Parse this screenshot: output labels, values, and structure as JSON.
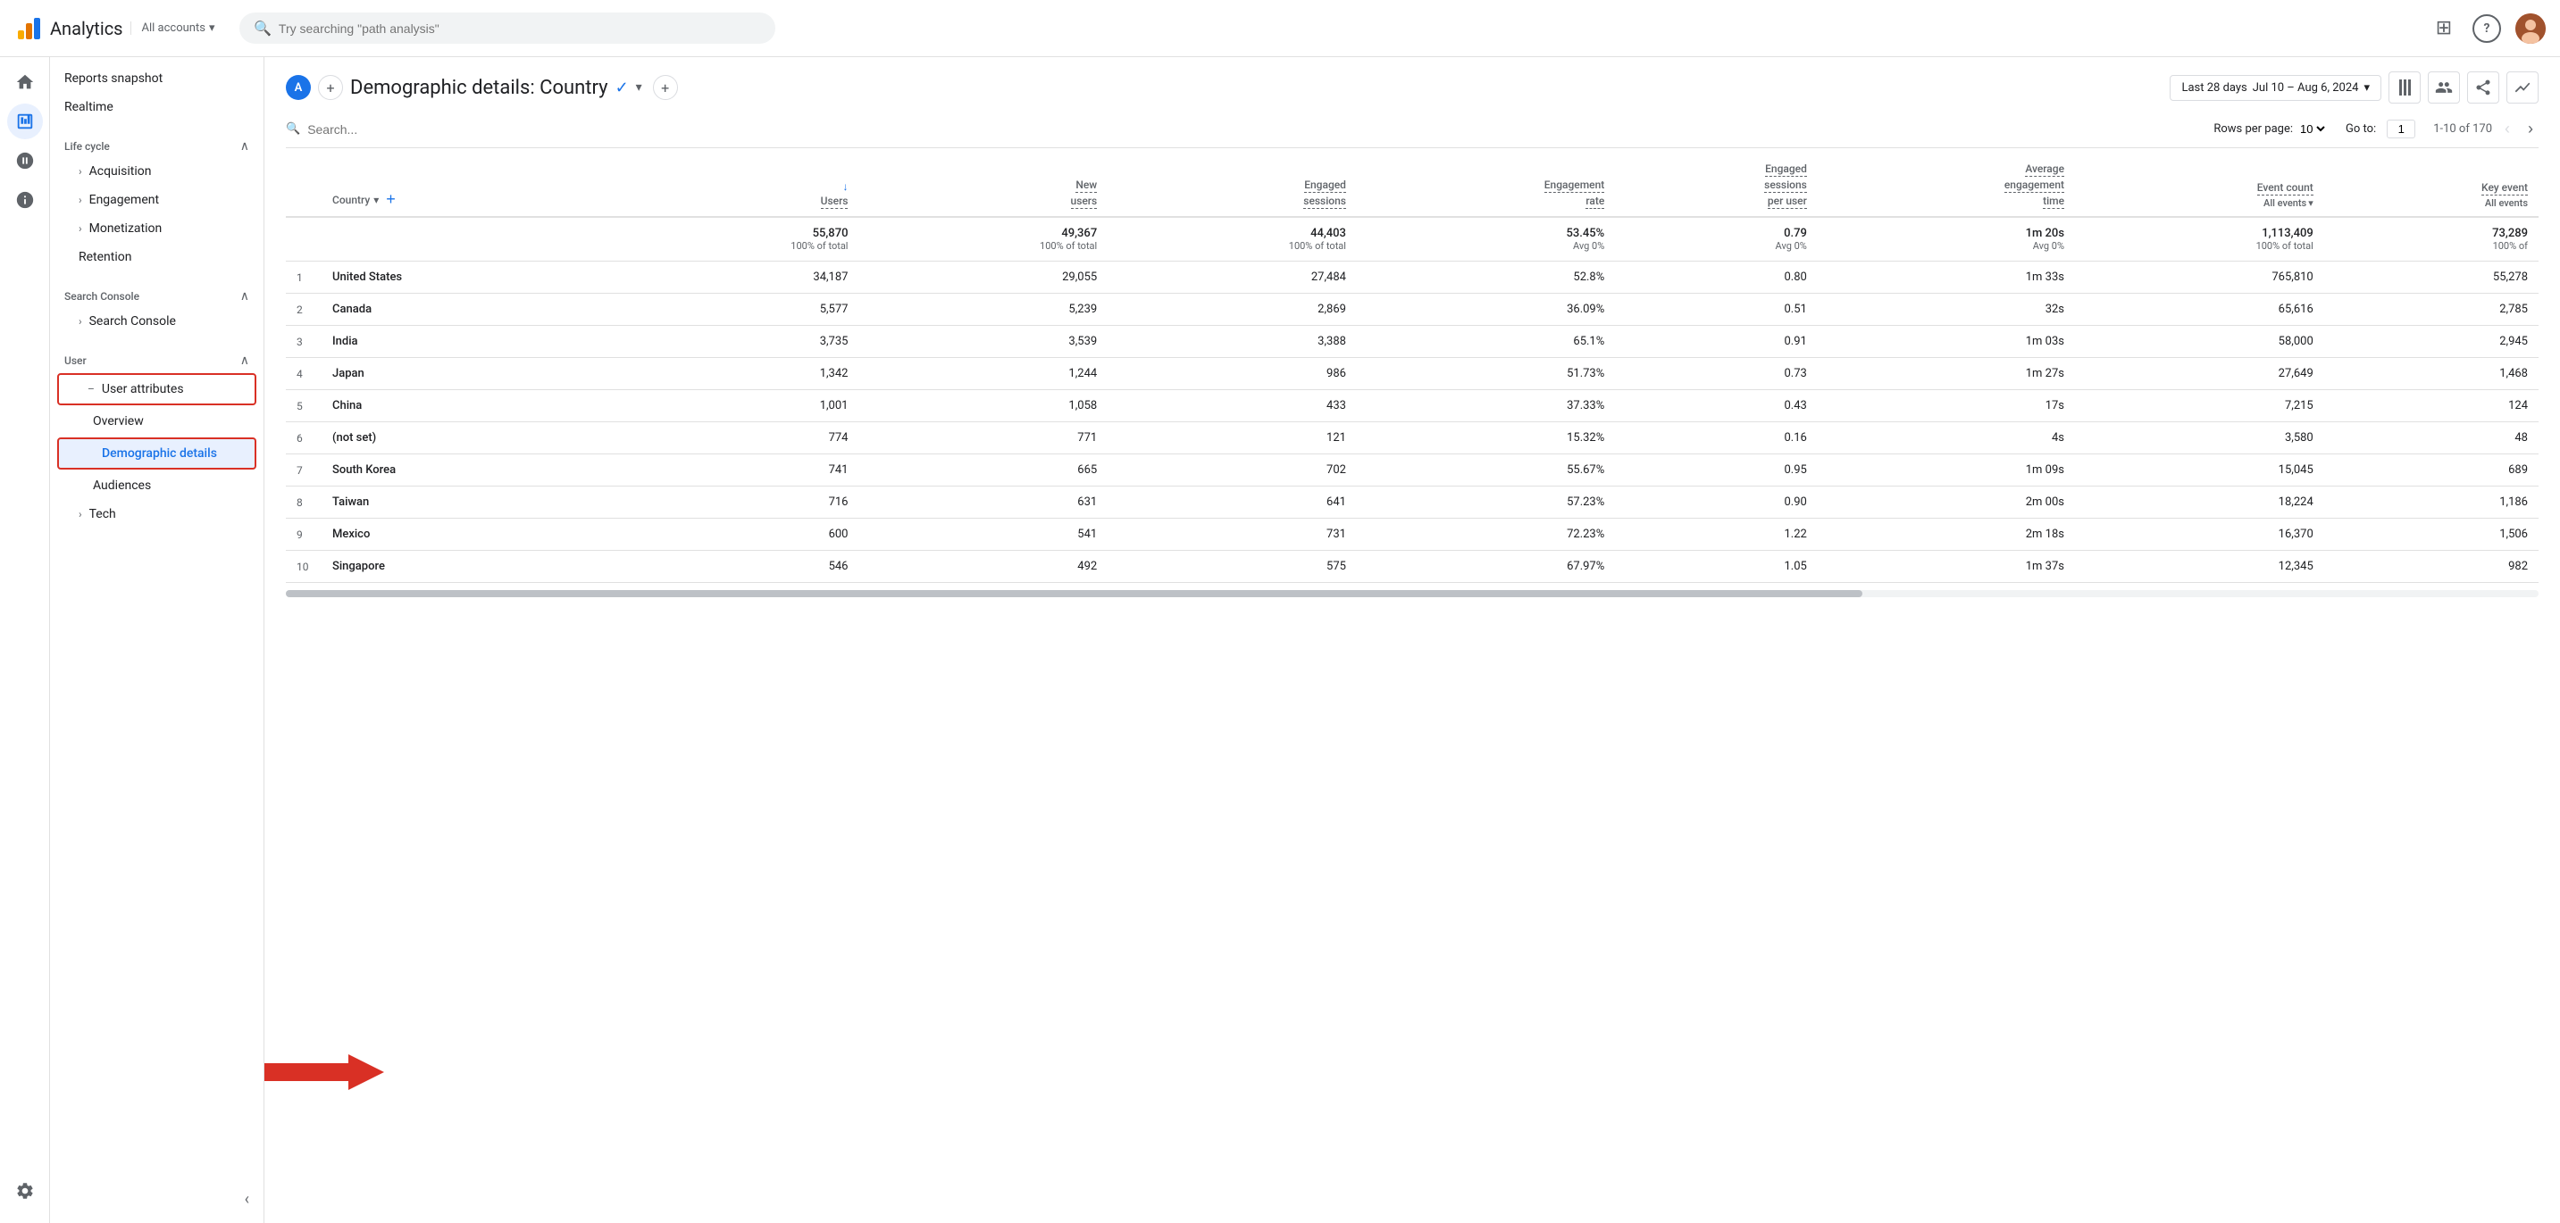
{
  "app": {
    "title": "Analytics",
    "all_accounts": "All accounts"
  },
  "topbar": {
    "search_placeholder": "Try searching \"path analysis\"",
    "date_range": "Last 28 days  Jul 10 – Aug 6, 2024"
  },
  "sidebar": {
    "reports_snapshot": "Reports snapshot",
    "realtime": "Realtime",
    "lifecycle_label": "Life cycle",
    "acquisition": "Acquisition",
    "engagement": "Engagement",
    "monetization": "Monetization",
    "retention": "Retention",
    "search_console_label": "Search Console",
    "search_console_item": "Search Console",
    "user_label": "User",
    "user_attributes": "User attributes",
    "overview": "Overview",
    "demographic_details": "Demographic details",
    "audiences": "Audiences",
    "tech": "Tech"
  },
  "report": {
    "title": "Demographic details: Country",
    "avatar_letter": "A",
    "date_label": "Last 28 days",
    "date_range": "Jul 10 – Aug 6, 2024"
  },
  "table": {
    "search_placeholder": "Search...",
    "rows_per_page_label": "Rows per page:",
    "rows_per_page": "10",
    "go_to_label": "Go to:",
    "page_number": "1",
    "page_info": "1-10 of 170",
    "columns": {
      "dimension": "Country",
      "users": "↓ Users",
      "new_users": "New users",
      "engaged_sessions": "Engaged sessions",
      "engagement_rate": "Engagement rate",
      "engaged_sessions_per_user": "Engaged sessions per user",
      "avg_engagement_time": "Average engagement time",
      "event_count": "Event count",
      "event_count_sub": "All events",
      "key_event": "Key event",
      "key_event_sub": "All events"
    },
    "totals": {
      "users": "55,870",
      "users_sub": "100% of total",
      "new_users": "49,367",
      "new_users_sub": "100% of total",
      "engaged_sessions": "44,403",
      "engaged_sessions_sub": "100% of total",
      "engagement_rate": "53.45%",
      "engagement_rate_sub": "Avg 0%",
      "engaged_sessions_per_user": "0.79",
      "engaged_sessions_per_user_sub": "Avg 0%",
      "avg_engagement_time": "1m 20s",
      "avg_engagement_time_sub": "Avg 0%",
      "event_count": "1,113,409",
      "event_count_sub": "100% of total",
      "key_event": "73,289",
      "key_event_sub": "100% of"
    },
    "rows": [
      {
        "rank": 1,
        "country": "United States",
        "users": "34,187",
        "new_users": "29,055",
        "engaged_sessions": "27,484",
        "engagement_rate": "52.8%",
        "engaged_sessions_per_user": "0.80",
        "avg_engagement_time": "1m 33s",
        "event_count": "765,810",
        "key_event": "55,278"
      },
      {
        "rank": 2,
        "country": "Canada",
        "users": "5,577",
        "new_users": "5,239",
        "engaged_sessions": "2,869",
        "engagement_rate": "36.09%",
        "engaged_sessions_per_user": "0.51",
        "avg_engagement_time": "32s",
        "event_count": "65,616",
        "key_event": "2,785"
      },
      {
        "rank": 3,
        "country": "India",
        "users": "3,735",
        "new_users": "3,539",
        "engaged_sessions": "3,388",
        "engagement_rate": "65.1%",
        "engaged_sessions_per_user": "0.91",
        "avg_engagement_time": "1m 03s",
        "event_count": "58,000",
        "key_event": "2,945"
      },
      {
        "rank": 4,
        "country": "Japan",
        "users": "1,342",
        "new_users": "1,244",
        "engaged_sessions": "986",
        "engagement_rate": "51.73%",
        "engaged_sessions_per_user": "0.73",
        "avg_engagement_time": "1m 27s",
        "event_count": "27,649",
        "key_event": "1,468"
      },
      {
        "rank": 5,
        "country": "China",
        "users": "1,001",
        "new_users": "1,058",
        "engaged_sessions": "433",
        "engagement_rate": "37.33%",
        "engaged_sessions_per_user": "0.43",
        "avg_engagement_time": "17s",
        "event_count": "7,215",
        "key_event": "124"
      },
      {
        "rank": 6,
        "country": "(not set)",
        "users": "774",
        "new_users": "771",
        "engaged_sessions": "121",
        "engagement_rate": "15.32%",
        "engaged_sessions_per_user": "0.16",
        "avg_engagement_time": "4s",
        "event_count": "3,580",
        "key_event": "48"
      },
      {
        "rank": 7,
        "country": "South Korea",
        "users": "741",
        "new_users": "665",
        "engaged_sessions": "702",
        "engagement_rate": "55.67%",
        "engaged_sessions_per_user": "0.95",
        "avg_engagement_time": "1m 09s",
        "event_count": "15,045",
        "key_event": "689"
      },
      {
        "rank": 8,
        "country": "Taiwan",
        "users": "716",
        "new_users": "631",
        "engaged_sessions": "641",
        "engagement_rate": "57.23%",
        "engaged_sessions_per_user": "0.90",
        "avg_engagement_time": "2m 00s",
        "event_count": "18,224",
        "key_event": "1,186"
      },
      {
        "rank": 9,
        "country": "Mexico",
        "users": "600",
        "new_users": "541",
        "engaged_sessions": "731",
        "engagement_rate": "72.23%",
        "engaged_sessions_per_user": "1.22",
        "avg_engagement_time": "2m 18s",
        "event_count": "16,370",
        "key_event": "1,506"
      },
      {
        "rank": 10,
        "country": "Singapore",
        "users": "546",
        "new_users": "492",
        "engaged_sessions": "575",
        "engagement_rate": "67.97%",
        "engaged_sessions_per_user": "1.05",
        "avg_engagement_time": "1m 37s",
        "event_count": "12,345",
        "key_event": "982"
      }
    ]
  },
  "icons": {
    "search": "🔍",
    "home": "🏠",
    "reports": "📊",
    "explore": "🔭",
    "advertising": "📢",
    "settings": "⚙",
    "grid": "⊞",
    "help": "?",
    "chevron_down": "▾",
    "chevron_left": "‹",
    "chevron_right": "›",
    "expand": "›",
    "collapse": "∧",
    "add": "+",
    "check": "✓",
    "columns": "|||",
    "share": "↗",
    "compare": "⟷",
    "filter": "▾"
  }
}
